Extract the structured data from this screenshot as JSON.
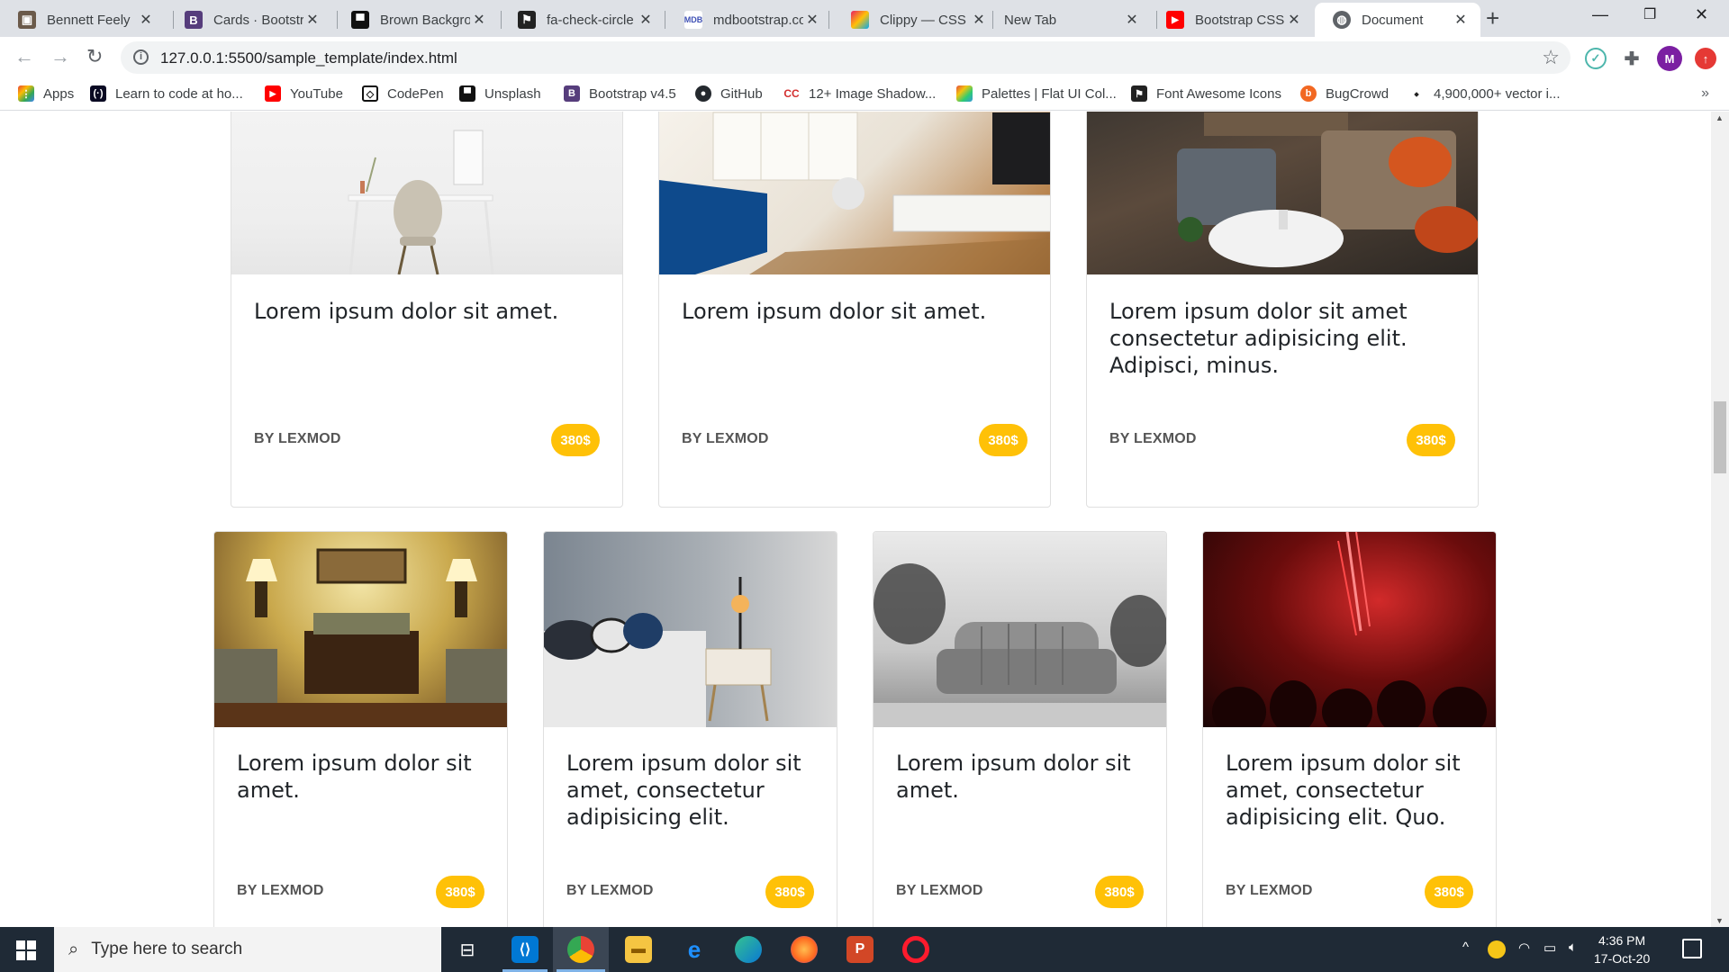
{
  "browser": {
    "tabs": [
      {
        "title": "Bennett Feely",
        "favicon": "photo-icon",
        "color": "#555555"
      },
      {
        "title": "Cards · Bootstra",
        "favicon": "bootstrap-icon",
        "color": "#563d7c"
      },
      {
        "title": "Brown Backgro",
        "favicon": "unsplash-icon",
        "color": "#111111"
      },
      {
        "title": "fa-check-circle",
        "favicon": "fontawesome-icon",
        "color": "#222222"
      },
      {
        "title": "mdbootstrap.co",
        "favicon": "mdb-icon",
        "color": "#3f51b5"
      },
      {
        "title": "Clippy — CSS c",
        "favicon": "clippy-icon",
        "color": "#e91e63"
      },
      {
        "title": "New Tab",
        "favicon": "",
        "color": ""
      },
      {
        "title": "Bootstrap CSS",
        "favicon": "youtube-icon",
        "color": "#ff0000"
      },
      {
        "title": "Document",
        "favicon": "globe-icon",
        "color": "#5f6368"
      }
    ],
    "url": "127.0.0.1:5500/sample_template/index.html",
    "profile_initial": "M",
    "bookmarks": [
      {
        "label": "Apps",
        "icon": "apps-grid-icon",
        "color": "#4285f4"
      },
      {
        "label": "Learn to code at ho...",
        "icon": "freecodecamp-icon",
        "color": "#0a0a23"
      },
      {
        "label": "YouTube",
        "icon": "youtube-icon",
        "color": "#ff0000"
      },
      {
        "label": "CodePen",
        "icon": "codepen-icon",
        "color": "#111111"
      },
      {
        "label": "Unsplash",
        "icon": "unsplash-icon",
        "color": "#111111"
      },
      {
        "label": "Bootstrap v4.5",
        "icon": "bootstrap-icon",
        "color": "#563d7c"
      },
      {
        "label": "GitHub",
        "icon": "github-icon",
        "color": "#24292e"
      },
      {
        "label": "12+ Image Shadow...",
        "icon": "cc-icon",
        "color": "#d32f2f"
      },
      {
        "label": "Palettes | Flat UI Col...",
        "icon": "palette-icon",
        "color": "#e67e22"
      },
      {
        "label": "Font Awesome Icons",
        "icon": "fontawesome-icon",
        "color": "#222222"
      },
      {
        "label": "BugCrowd",
        "icon": "bugcrowd-icon",
        "color": "#f26822"
      },
      {
        "label": "4,900,000+ vector i...",
        "icon": "freepik-icon",
        "color": "#222222"
      }
    ]
  },
  "cards": [
    {
      "title": "Lorem ipsum dolor sit amet.",
      "author": "BY LEXMOD",
      "price": "380$",
      "image": "white-desk-chair"
    },
    {
      "title": "Lorem ipsum dolor sit amet.",
      "author": "BY LEXMOD",
      "price": "380$",
      "image": "living-room-blue-sofa"
    },
    {
      "title": "Lorem ipsum dolor sit amet consectetur adipisicing elit. Adipisci, minus.",
      "author": "BY LEXMOD",
      "price": "380$",
      "image": "lounge-orange-cushions"
    },
    {
      "title": "Lorem ipsum dolor sit amet.",
      "author": "BY LEXMOD",
      "price": "380$",
      "image": "hotel-bedroom-lamps"
    },
    {
      "title": "Lorem ipsum dolor sit amet, consectetur adipisicing elit.",
      "author": "BY LEXMOD",
      "price": "380$",
      "image": "bed-nightstand-lamp"
    },
    {
      "title": "Lorem ipsum dolor sit amet.",
      "author": "BY LEXMOD",
      "price": "380$",
      "image": "grey-sofa-plants"
    },
    {
      "title": "Lorem ipsum dolor sit amet, consectetur adipisicing elit. Quo.",
      "author": "BY LEXMOD",
      "price": "380$",
      "image": "red-laser-concert"
    }
  ],
  "colors": {
    "price_badge": "#ffc107",
    "taskbar": "#1f2a36"
  },
  "taskbar": {
    "search_placeholder": "Type here to search",
    "time": "4:36 PM",
    "date": "17-Oct-20"
  }
}
